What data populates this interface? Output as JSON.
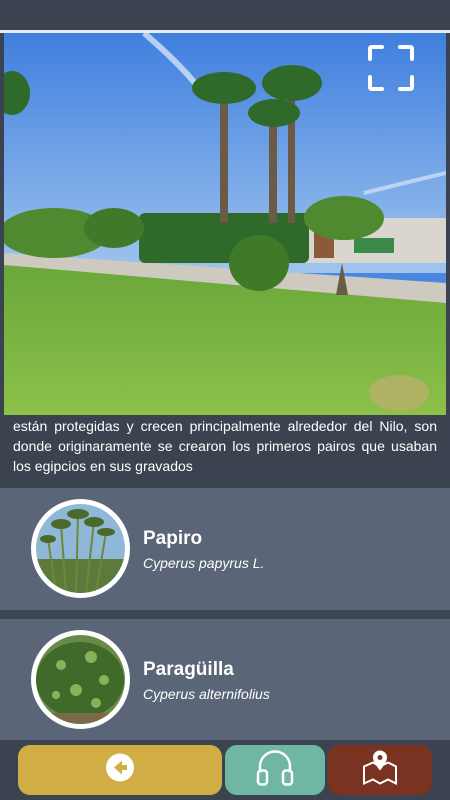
{
  "description": {
    "text": "están protegidas y crecen principalmente alrededor del Nilo, son donde originaramente se crearon los primeros pairos que usaban los egipcios en sus gravados"
  },
  "plants": [
    {
      "name": "Papiro",
      "scientific_name": "Cyperus papyrus L."
    },
    {
      "name": "Paragüilla",
      "scientific_name": "Cyperus alternifolius"
    }
  ],
  "icons": {
    "fullscreen": "fullscreen-icon",
    "back": "arrow-left-icon",
    "audio": "headphones-icon",
    "map": "map-location-icon"
  },
  "colors": {
    "background": "#3b4350",
    "card": "#5a6577",
    "back_button": "#d1ad45",
    "audio_button": "#6fb7a2",
    "map_button": "#7a3320"
  }
}
